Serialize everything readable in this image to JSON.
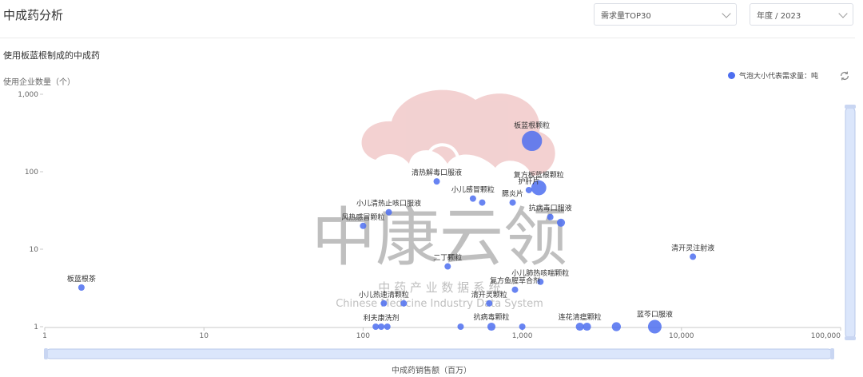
{
  "header": {
    "title": "中成药分析",
    "filter_rank": "需求量TOP30",
    "filter_period": "年度 / 2023"
  },
  "section": {
    "title": "使用板蓝根制成的中成药"
  },
  "watermark": {
    "main": "中康云领",
    "sub": "中 药 产 业 数 据 系 统",
    "en": "Chinese Medicine Industry Data System"
  },
  "colors": {
    "bubble": "#4d6ef0",
    "slider": "#dbe6fb",
    "axis": "#c8c8c8"
  },
  "chart_data": {
    "type": "scatter",
    "xscale": "log",
    "yscale": "log",
    "xlim": [
      1,
      100000
    ],
    "ylim": [
      1,
      1000
    ],
    "xlabel": "中成药销售额（百万）",
    "ylabel": "使用企业数量（个）",
    "x_ticks": [
      "1",
      "10",
      "100",
      "1,000",
      "10,000",
      "100,000"
    ],
    "y_ticks": [
      "1",
      "10",
      "100",
      "1,000"
    ],
    "legend": "气泡大小代表需求量：吨",
    "legend_position": "top-right",
    "points": [
      {
        "label": "板蓝根颗粒",
        "x": 1150,
        "y": 250,
        "size": 10
      },
      {
        "label": "复方板蓝根颗粒",
        "x": 1270,
        "y": 62,
        "size": 5.5
      },
      {
        "label": "护肝片",
        "x": 1100,
        "y": 58,
        "size": 1
      },
      {
        "label": "清热解毒口服液",
        "x": 290,
        "y": 75,
        "size": 1
      },
      {
        "label": "小儿感冒颗粒",
        "x": 490,
        "y": 45,
        "size": 1
      },
      {
        "label": "",
        "x": 560,
        "y": 40,
        "size": 1
      },
      {
        "label": "腮炎片",
        "x": 870,
        "y": 40,
        "size": 1
      },
      {
        "label": "小儿清热止咳口服液",
        "x": 145,
        "y": 30,
        "size": 1
      },
      {
        "label": "风热感冒颗粒",
        "x": 100,
        "y": 20,
        "size": 1
      },
      {
        "label": "抗病毒口服液",
        "x": 1500,
        "y": 26,
        "size": 1
      },
      {
        "label": "",
        "x": 1750,
        "y": 22,
        "size": 1.6
      },
      {
        "label": "清开灵注射液",
        "x": 11800,
        "y": 8,
        "size": 1
      },
      {
        "label": "二丁颗粒",
        "x": 340,
        "y": 6,
        "size": 1
      },
      {
        "label": "小儿肺热咳喘颗粒",
        "x": 1300,
        "y": 3.8,
        "size": 1
      },
      {
        "label": "复方鱼腥草合剂",
        "x": 900,
        "y": 3.0,
        "size": 1
      },
      {
        "label": "板蓝根茶",
        "x": 1.7,
        "y": 3.2,
        "size": 1
      },
      {
        "label": "小儿热速清颗粒",
        "x": 135,
        "y": 2.0,
        "size": 1
      },
      {
        "label": "",
        "x": 180,
        "y": 2.0,
        "size": 1
      },
      {
        "label": "清开灵颗粒",
        "x": 620,
        "y": 2.0,
        "size": 1
      },
      {
        "label": "利夫康洗剂",
        "x": 130,
        "y": 1,
        "size": 1
      },
      {
        "label": "",
        "x": 142,
        "y": 1,
        "size": 1
      },
      {
        "label": "",
        "x": 120,
        "y": 1,
        "size": 1
      },
      {
        "label": "抗病毒颗粒",
        "x": 640,
        "y": 1,
        "size": 1.6
      },
      {
        "label": "",
        "x": 410,
        "y": 1,
        "size": 1
      },
      {
        "label": "",
        "x": 1000,
        "y": 1,
        "size": 1
      },
      {
        "label": "连花清瘟颗粒",
        "x": 2300,
        "y": 1,
        "size": 1.6
      },
      {
        "label": "",
        "x": 2550,
        "y": 1,
        "size": 1.6
      },
      {
        "label": "",
        "x": 3900,
        "y": 1,
        "size": 2
      },
      {
        "label": "蓝芩口服液",
        "x": 6800,
        "y": 1,
        "size": 4.5
      }
    ]
  }
}
